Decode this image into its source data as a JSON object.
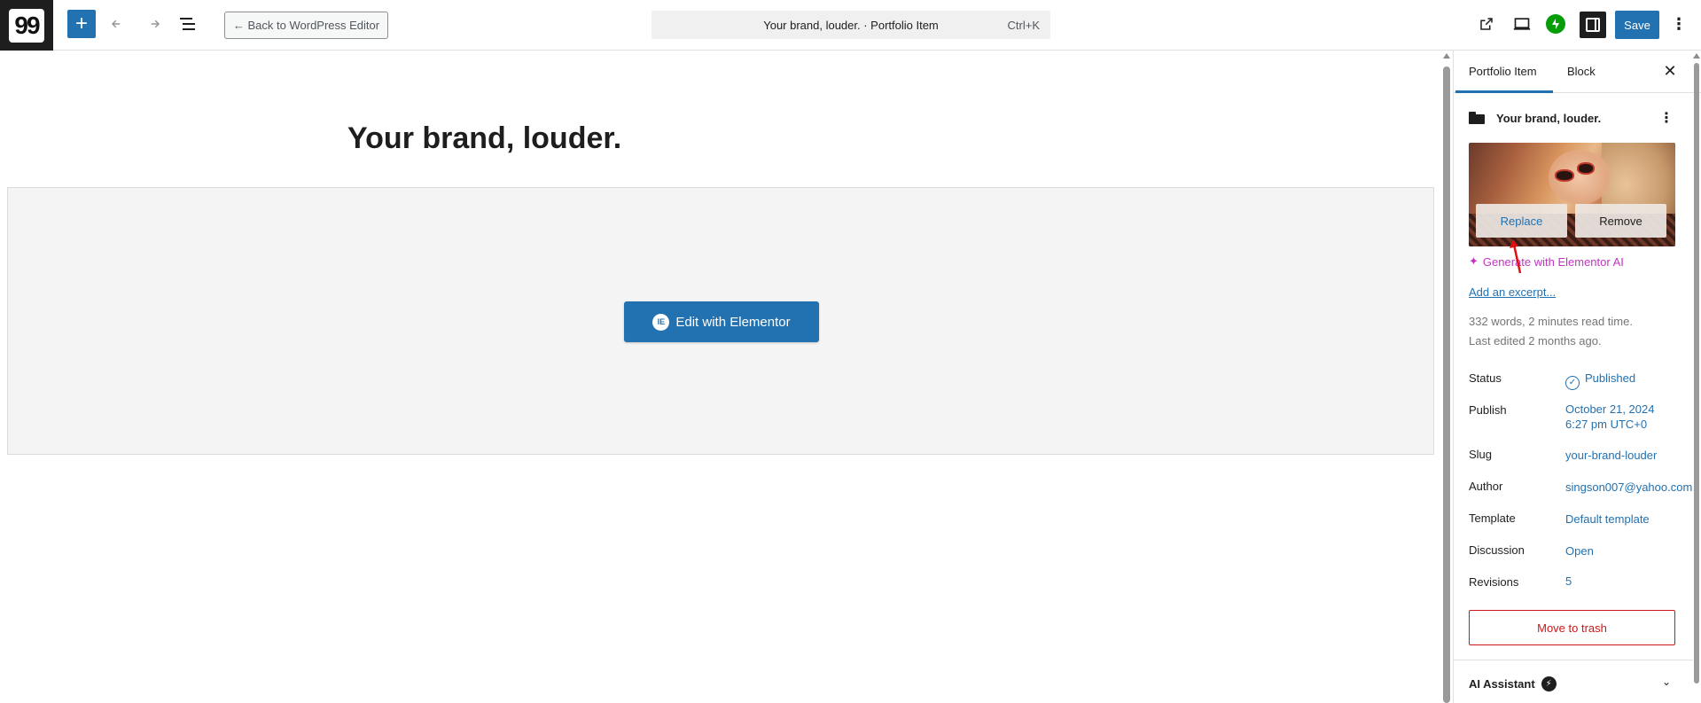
{
  "topbar": {
    "logo_text": "99",
    "inserter_icon": "plus-icon",
    "undo_icon": "undo-icon",
    "redo_icon": "redo-icon",
    "list_view_icon": "list-view-icon",
    "back_label": "← Back to WordPress Editor",
    "command_title": "Your brand, louder. · Portfolio Item",
    "command_shortcut": "Ctrl+K",
    "view_post_icon": "external-link-icon",
    "preview_icon": "desktop-preview-icon",
    "jetpack_icon": "jetpack-icon",
    "settings_icon": "sidebar-toggle-icon",
    "save_label": "Save",
    "more_icon": "kebab-menu-icon"
  },
  "canvas": {
    "post_title": "Your brand, louder.",
    "elementor_button_label": "Edit with Elementor",
    "elementor_icon_text": "IE"
  },
  "sidebar": {
    "tabs": [
      {
        "label": "Portfolio Item",
        "active": true
      },
      {
        "label": "Block",
        "active": false
      }
    ],
    "post_card_title": "Your brand, louder.",
    "featured_image": {
      "replace_label": "Replace",
      "remove_label": "Remove"
    },
    "generate_ai_label": "Generate with Elementor AI",
    "excerpt_label": "Add an excerpt...",
    "word_count_text": "332 words, 2 minutes read time.",
    "last_edited_text": "Last edited 2 months ago.",
    "rows": {
      "status": {
        "label": "Status",
        "value": "Published"
      },
      "publish": {
        "label": "Publish",
        "value_line1": "October 21, 2024",
        "value_line2": "6:27 pm UTC+0"
      },
      "slug": {
        "label": "Slug",
        "value": "your-brand-louder"
      },
      "author": {
        "label": "Author",
        "value": "singson007@yahoo.com"
      },
      "template": {
        "label": "Template",
        "value": "Default template"
      },
      "discussion": {
        "label": "Discussion",
        "value": "Open"
      },
      "revisions": {
        "label": "Revisions",
        "value": "5"
      }
    },
    "trash_label": "Move to trash",
    "ai_assistant_label": "AI Assistant"
  },
  "colors": {
    "accent": "#2271b1",
    "danger": "#cc1818",
    "ai_pink": "#c036c0",
    "jetpack_green": "#069e08"
  }
}
